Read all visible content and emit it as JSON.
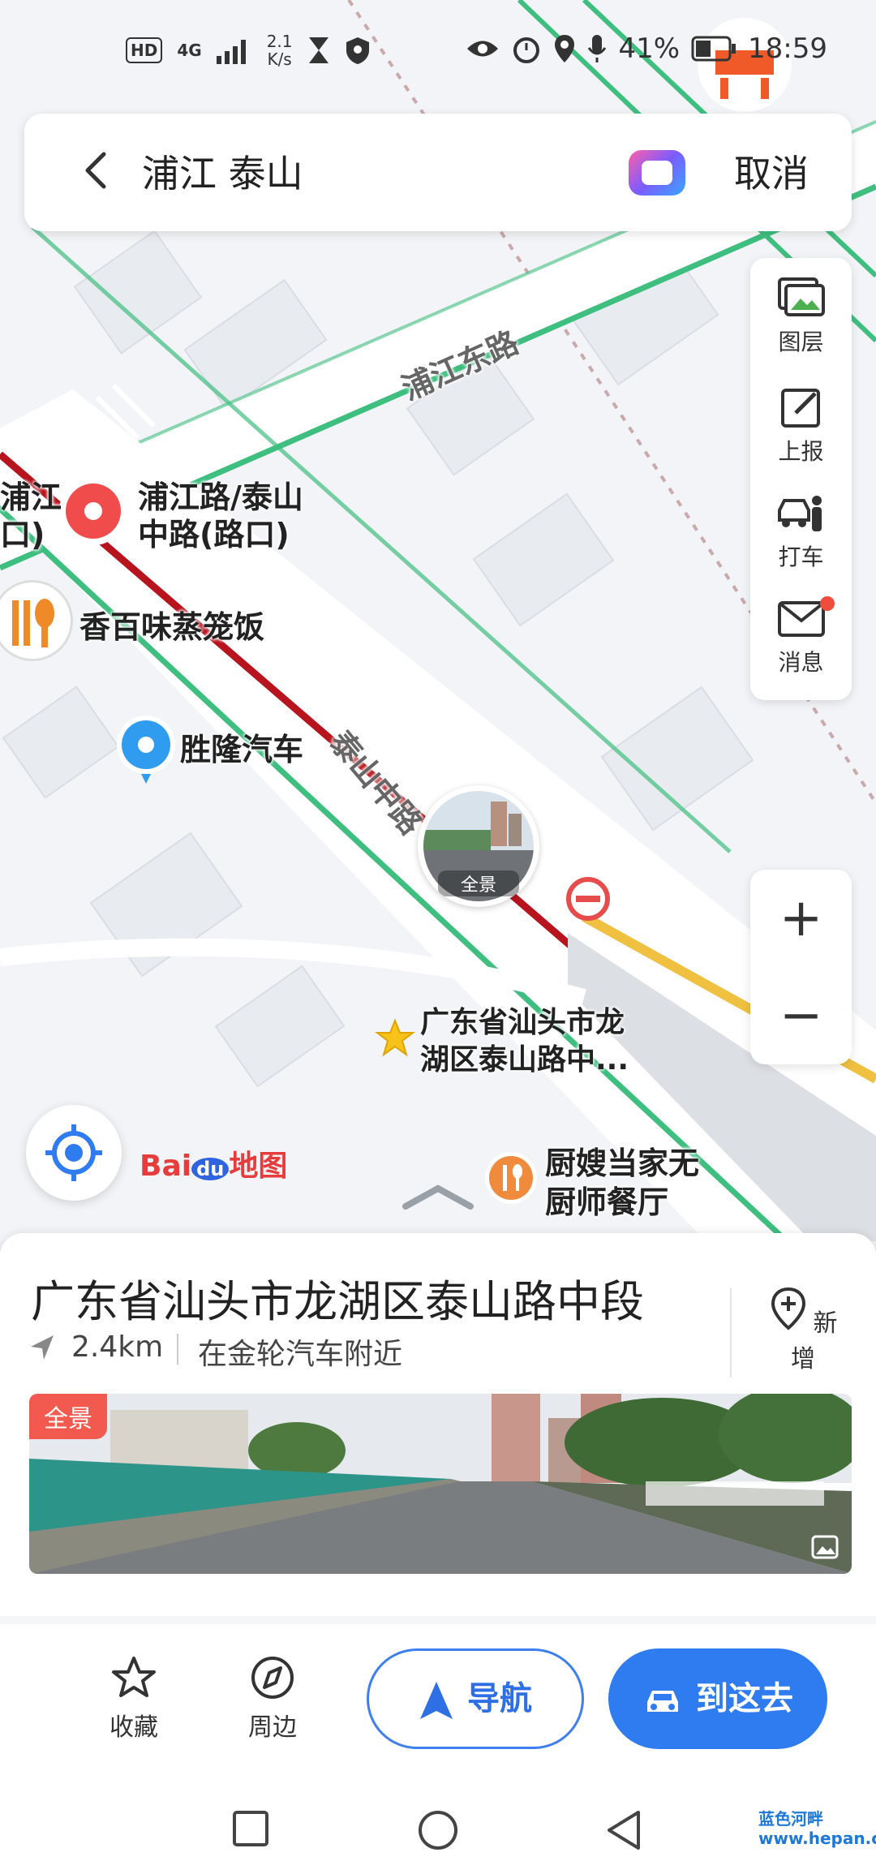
{
  "status_bar": {
    "network_badge": "HD",
    "network_type": "4G",
    "speed_value": "2.1",
    "speed_unit": "K/s",
    "battery_percent": "41%",
    "time": "18:59"
  },
  "search": {
    "query": "浦江 泰山",
    "cancel_label": "取消"
  },
  "tools": [
    {
      "icon": "layers-icon",
      "label": "图层"
    },
    {
      "icon": "report-icon",
      "label": "上报"
    },
    {
      "icon": "taxi-icon",
      "label": "打车"
    },
    {
      "icon": "message-icon",
      "label": "消息"
    }
  ],
  "zoom": {
    "in_label": "+",
    "out_label": "−"
  },
  "map": {
    "roads": {
      "pujiang_east": "浦江东路",
      "taishan_mid": "泰山中路"
    },
    "pois": {
      "intersection_line1": "浦江路/泰山",
      "intersection_line2": "中路(路口)",
      "intersection_left_line1": "浦江",
      "intersection_left_line2": "口)",
      "restaurant1": "香百味蒸笼饭",
      "auto_shop": "胜隆汽车",
      "selected_line1": "广东省汕头市龙",
      "selected_line2": "湖区泰山路中...",
      "restaurant2_line1": "厨嫂当家无",
      "restaurant2_line2": "厨师餐厅"
    },
    "streetview_badge": "全景",
    "brand_logo": "Bai du 地图"
  },
  "card": {
    "title": "广东省汕头市龙湖区泰山路中段",
    "distance": "2.4km",
    "nearby": "在金轮汽车附近",
    "add_label": "新增",
    "panorama_badge": "全景"
  },
  "actions": {
    "favorite_label": "收藏",
    "nearby_label": "周边",
    "navigate_label": "导航",
    "go_label": "到这去"
  },
  "watermark": "蓝色河畔 www.hepan.com"
}
